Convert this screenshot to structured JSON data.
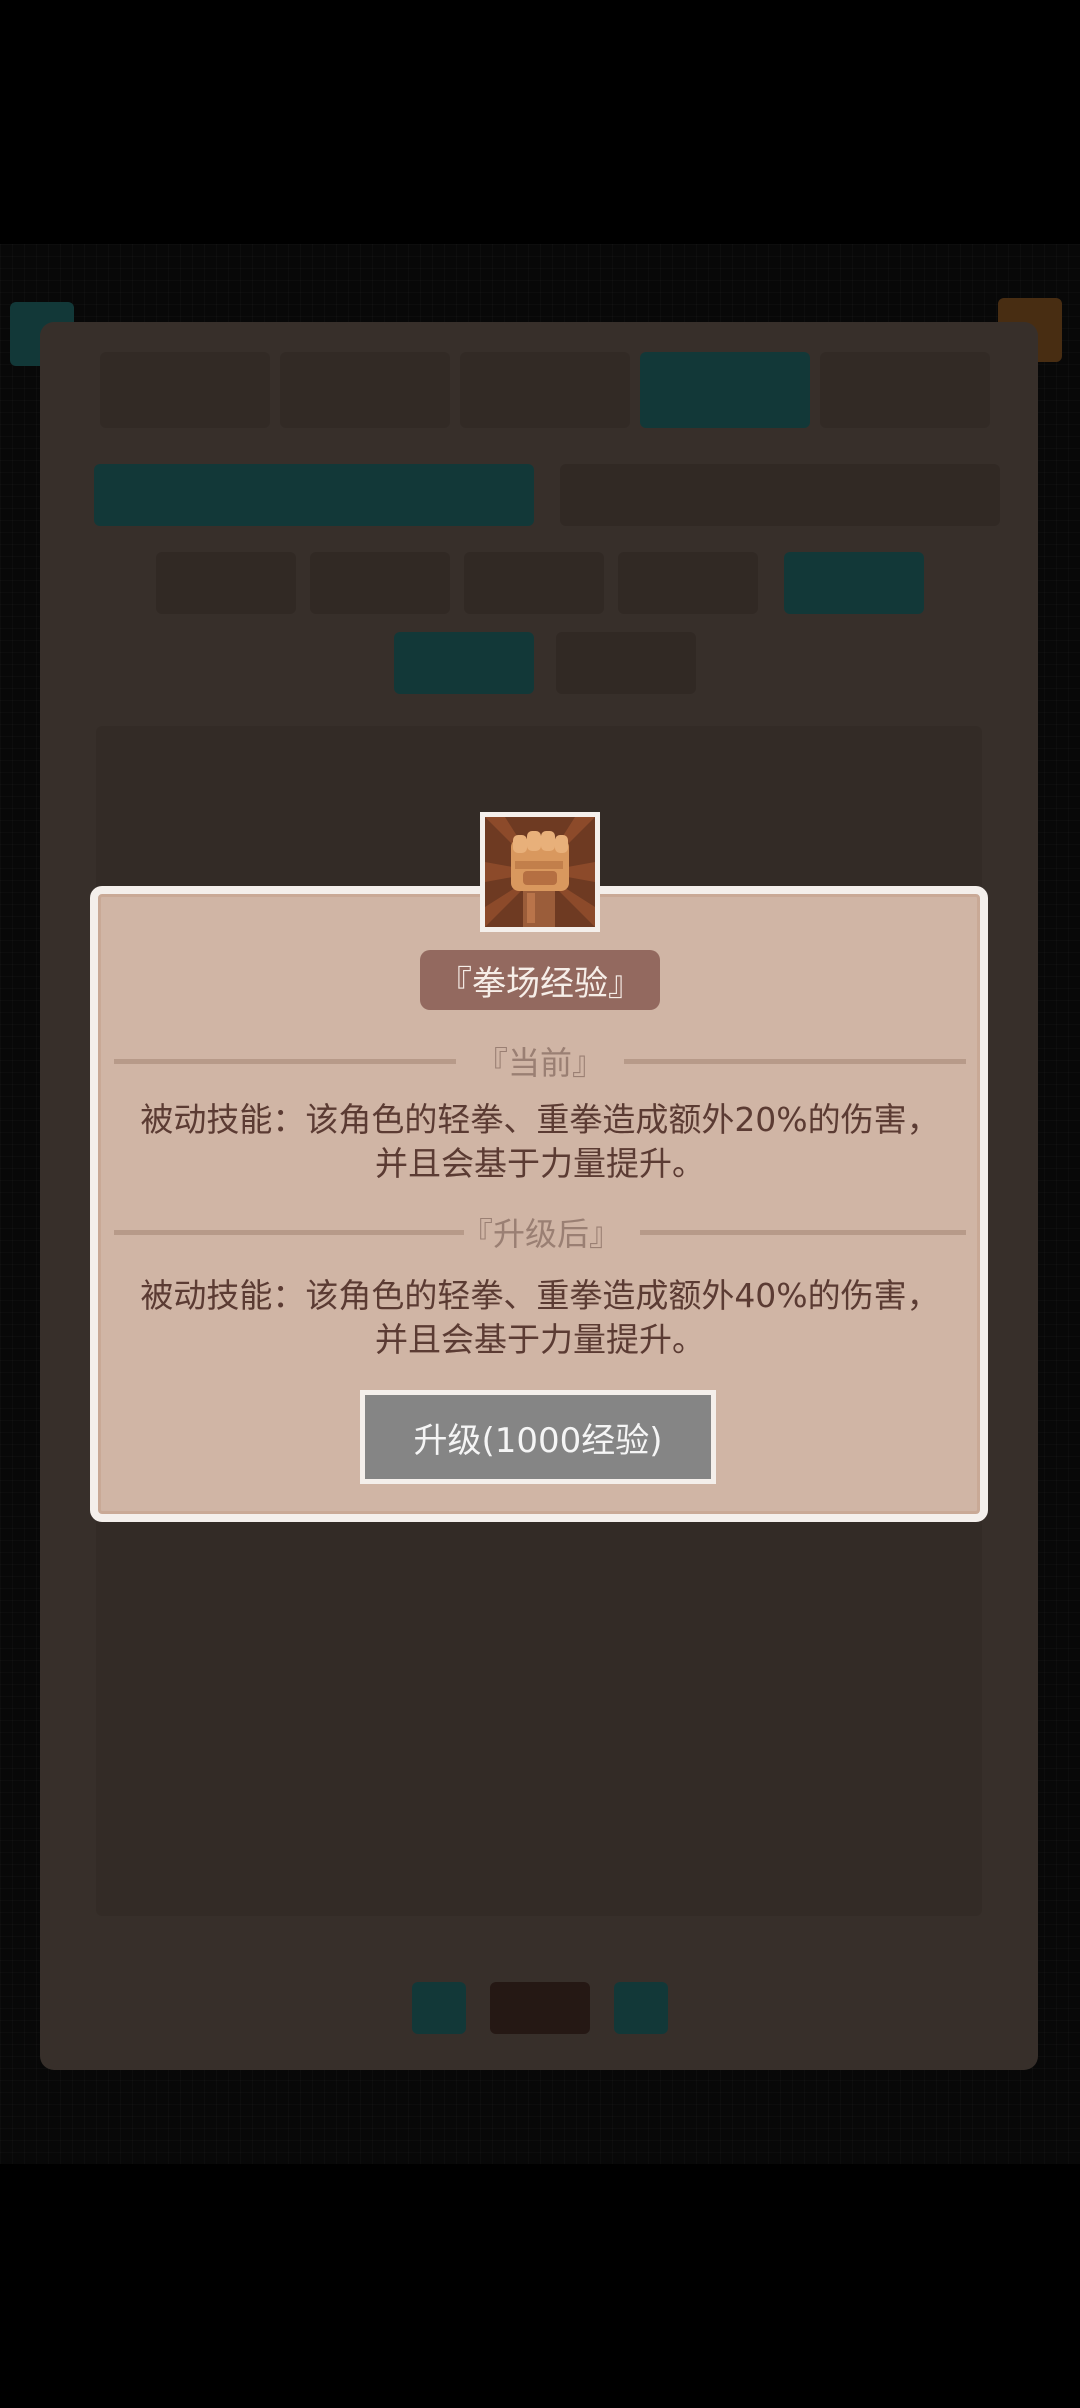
{
  "skill": {
    "title": "『拳场经验』",
    "current_label": "『当前』",
    "current_desc_line1": "被动技能：该角色的轻拳、重拳造成额外20%的伤害，",
    "current_desc_line2": "并且会基于力量提升。",
    "next_label": "『升级后』",
    "next_desc_line1": "被动技能：该角色的轻拳、重拳造成额外40%的伤害，",
    "next_desc_line2": "并且会基于力量提升。",
    "upgrade_button_label": "升级(1000经验)",
    "icon": "fist-icon"
  },
  "colors": {
    "modal_bg": "#d0b5a5",
    "title_bg": "#93695f",
    "button_bg": "#858585",
    "accent_teal": "#2f8c8d"
  }
}
